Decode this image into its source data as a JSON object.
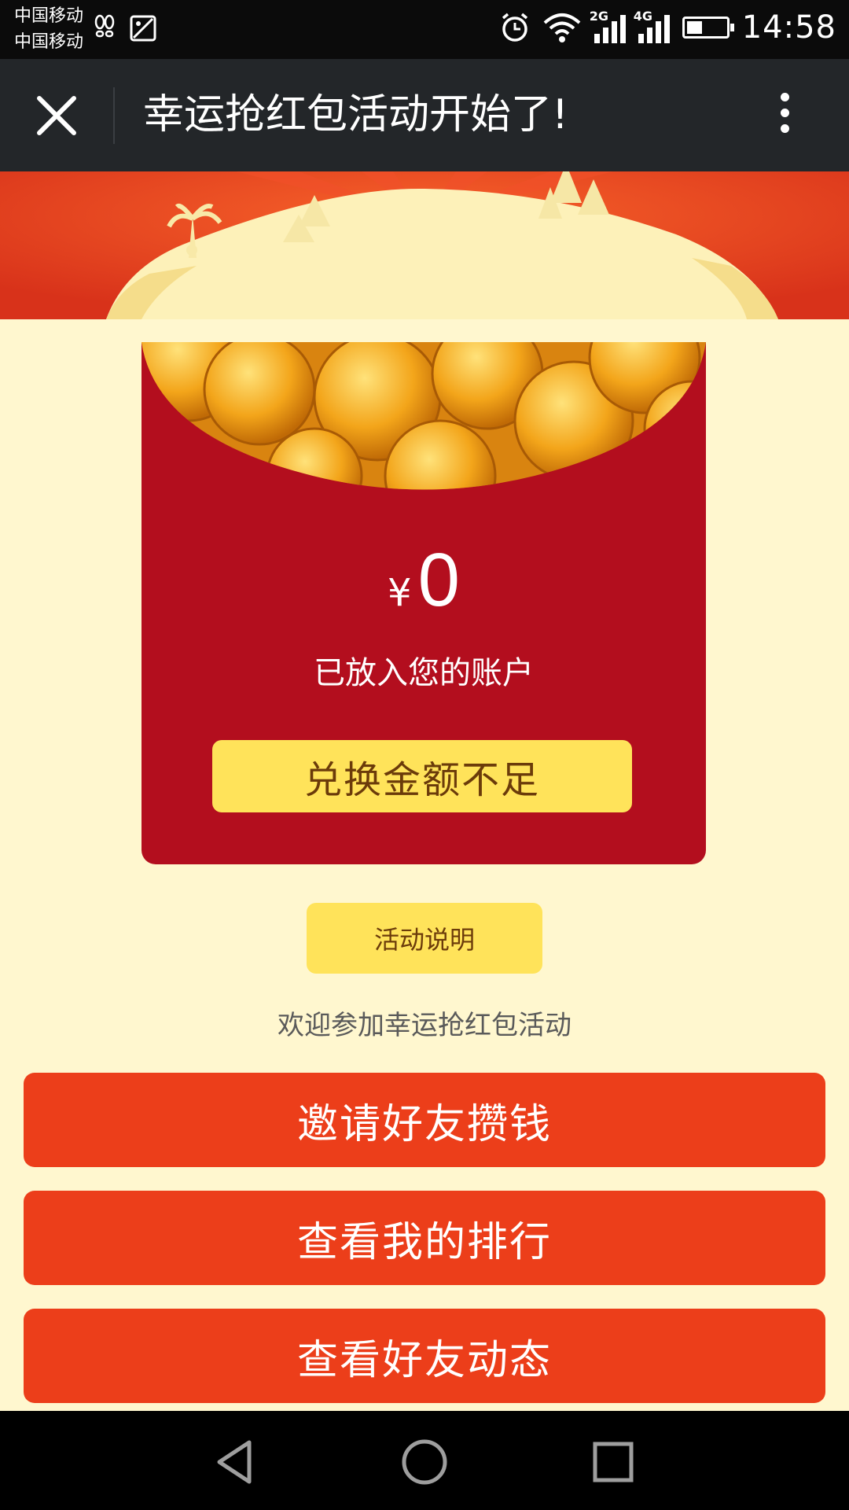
{
  "status_bar": {
    "carrier_1": "中国移动",
    "carrier_2": "中国移动",
    "network_1": "2G",
    "network_2": "4G",
    "battery_level": 0.4,
    "time": "14:58",
    "icons": [
      "footprint-icon",
      "image-icon",
      "alarm-icon",
      "wifi-icon",
      "signal-icon",
      "battery-icon"
    ]
  },
  "title_bar": {
    "title": "幸运抢红包活动开始了!"
  },
  "envelope": {
    "currency": "¥",
    "amount": "0",
    "deposited_text": "已放入您的账户",
    "exchange_button": "兑换金额不足"
  },
  "rules_button": "活动说明",
  "welcome_text": "欢迎参加幸运抢红包活动",
  "actions": {
    "invite": "邀请好友攒钱",
    "ranking": "查看我的排行",
    "friends": "查看好友动态"
  },
  "colors": {
    "banner_red": "#e8391c",
    "envelope_red": "#b30e1e",
    "button_yellow": "#ffe35a",
    "action_red": "#ec3e1a",
    "page_bg": "#fff7cf"
  }
}
